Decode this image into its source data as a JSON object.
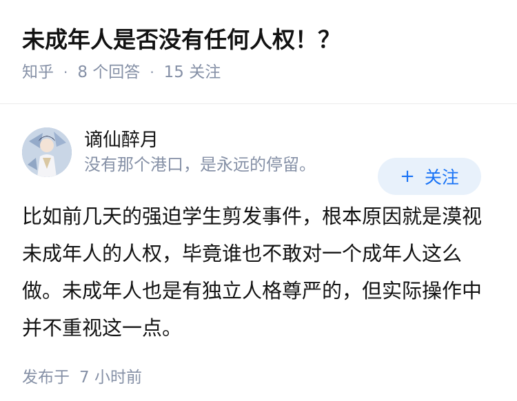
{
  "question": {
    "title": "未成年人是否没有任何人权！？",
    "source": "知乎",
    "answers": "8 个回答",
    "followers": "15 关注"
  },
  "answer": {
    "author_name": "谪仙醉月",
    "author_bio": "没有那个港口，是永远的停留。",
    "follow_label": "关注",
    "content": "比如前几天的强迫学生剪发事件，根本原因就是漠视未成年人的人权，毕竟谁也不敢对一个成年人这么做。未成年人也是有独立人格尊严的，但实际操作中并不重视这一点。",
    "published_label": "发布于",
    "published_time": "7 小时前"
  },
  "colors": {
    "brand": "#1772f6",
    "muted": "#8590a6",
    "follow_bg": "#e8f1fb"
  }
}
